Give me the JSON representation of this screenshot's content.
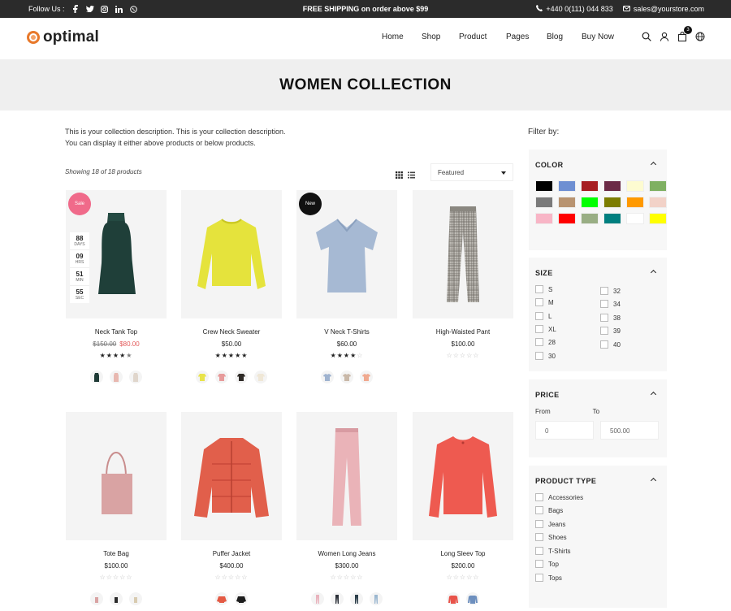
{
  "topbar": {
    "follow_label": "Follow Us :",
    "social_icons": [
      "facebook-icon",
      "twitter-icon",
      "instagram-icon",
      "linkedin-icon",
      "whatsapp-icon"
    ],
    "shipping": "FREE SHIPPING on order above $99",
    "phone": "+440 0(111) 044 833",
    "email": "sales@yourstore.com"
  },
  "header": {
    "logo": "optimal",
    "nav": [
      "Home",
      "Shop",
      "Product",
      "Pages",
      "Blog",
      "Buy Now"
    ],
    "cart_count": "3"
  },
  "banner": {
    "title": "WOMEN COLLECTION"
  },
  "collection": {
    "desc_line1": "This is your collection description. This is your collection description.",
    "desc_line2": "You can display it either above products or below products.",
    "showing": "Showing 18 of 18 products",
    "sort": "Featured"
  },
  "products": [
    {
      "name": "Neck Tank Top",
      "old_price": "$150.00",
      "price": "$80.00",
      "badge": "Sale",
      "rating": 4.5,
      "countdown": [
        {
          "n": "88",
          "l": "DAYS"
        },
        {
          "n": "09",
          "l": "HRS"
        },
        {
          "n": "51",
          "l": "MIN"
        },
        {
          "n": "55",
          "l": "SEC"
        }
      ],
      "swatches": [
        "#1f3b36",
        "#e8d0cc",
        "#f2f2f2"
      ]
    },
    {
      "name": "Crew Neck Sweater",
      "price": "$50.00",
      "rating": 5,
      "swatches": [
        "#e8e34a",
        "#e79b9b",
        "#2e2a26",
        "#efe7d6"
      ]
    },
    {
      "name": "V Neck T-Shirts",
      "price": "$60.00",
      "badge": "New",
      "rating": 4,
      "swatches": [
        "#9fb3cf",
        "#c9b8a8",
        "#f0a98f"
      ]
    },
    {
      "name": "High-Waisted Pant",
      "price": "$100.00",
      "rating": 0
    },
    {
      "name": "Tote Bag",
      "price": "$100.00",
      "rating": 0,
      "swatches": [
        "#d9a3a3",
        "#2a2a2a",
        "#e8dcc6"
      ]
    },
    {
      "name": "Puffer Jacket",
      "price": "$400.00",
      "rating": 0,
      "swatches": [
        "#e45a44",
        "#1d1d1d"
      ]
    },
    {
      "name": "Women Long Jeans",
      "price": "$300.00",
      "rating": 0,
      "swatches": [
        "#e9b3bd",
        "#2a2f37",
        "#2b3e4a",
        "#9bb7d0"
      ]
    },
    {
      "name": "Long Sleev Top",
      "price": "$200.00",
      "rating": 0,
      "swatches": [
        "#e8534a",
        "#6d8fbe"
      ]
    }
  ],
  "sidebar": {
    "filter_by": "Filter by:",
    "color_title": "COLOR",
    "colors": [
      "#000000",
      "#6e8fd2",
      "#a71e22",
      "#6b2a46",
      "#fdfbd1",
      "#7fb062",
      "#7a7a7a",
      "#b89370",
      "#00ff00",
      "#7d7d00",
      "#ff9900",
      "#f2d2c8",
      "#f8b5c6",
      "#ff0000",
      "#99ae84",
      "#007f7f",
      "#ffffff",
      "#ffff00"
    ],
    "size_title": "SIZE",
    "sizes_col1": [
      "S",
      "M",
      "L",
      "XL",
      "28",
      "30"
    ],
    "sizes_col2": [
      "32",
      "34",
      "38",
      "39",
      "40"
    ],
    "price_title": "PRICE",
    "price_from_label": "From",
    "price_to_label": "To",
    "price_from": "0",
    "price_to": "500.00",
    "type_title": "PRODUCT TYPE",
    "types": [
      "Accessories",
      "Bags",
      "Jeans",
      "Shoes",
      "T-Shirts",
      "Top",
      "Tops"
    ]
  }
}
